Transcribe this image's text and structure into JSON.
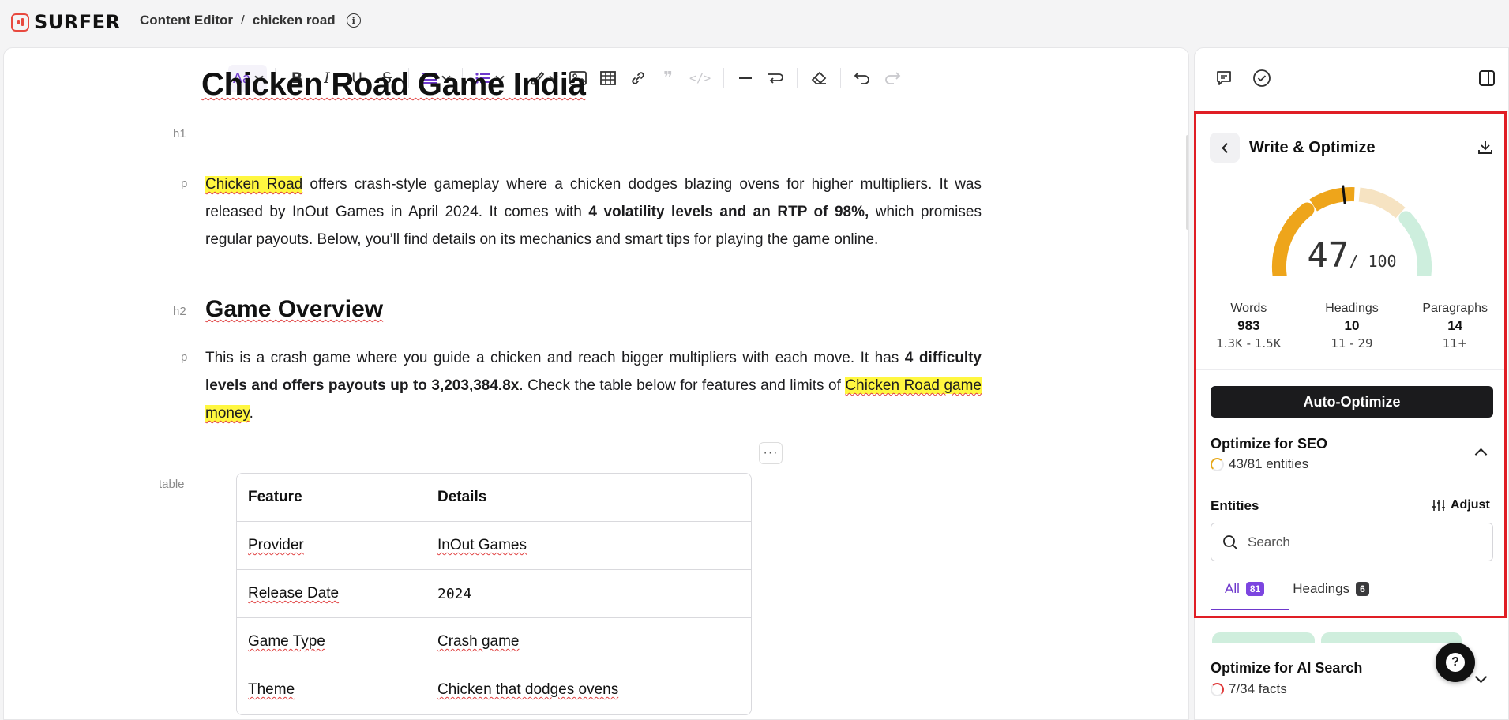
{
  "app": {
    "logo_text": "SURFER",
    "brand_color": "#e8493f",
    "accent_color": "#6e38cc"
  },
  "breadcrumb": {
    "section": "Content Editor",
    "separator": "/",
    "document": "chicken road",
    "info_icon": "info-icon"
  },
  "toolbar": {
    "font_button": "Aa",
    "items": [
      "text-format",
      "bold",
      "italic",
      "underline",
      "strikethrough",
      "align",
      "bullet-list",
      "paint",
      "image",
      "table",
      "link",
      "quote",
      "code",
      "divider",
      "line-break",
      "clear-format",
      "undo",
      "redo"
    ]
  },
  "editor": {
    "h1_tag": "h1",
    "h1": "Chicken Road Game India",
    "p_tag": "p",
    "p1": {
      "hl": "Chicken Road",
      "a": " offers crash-style gameplay where a chicken dodges blazing ovens for higher multipliers. It was released by InOut Games in April 2024. It comes with ",
      "b": "4 volatility levels and an RTP of 98%,",
      "c": " which promises regular payouts. Below, you’ll find details on its mechanics and smart tips for playing the game online."
    },
    "h2_tag": "h2",
    "h2": "Game Overview",
    "p2": {
      "a": "This is a crash game where you guide a chicken and reach bigger multipliers with each move. It has ",
      "b": "4 difficulty levels and offers payouts up to 3,203,384.8x",
      "c": ". Check the table below for features and limits of ",
      "hl": "Chicken Road game money",
      "d": "."
    },
    "table_tag": "table",
    "more_button": "···",
    "table": {
      "headers": [
        "Feature",
        "Details"
      ],
      "rows": [
        [
          "Provider",
          "InOut Games"
        ],
        [
          "Release Date",
          "2024"
        ],
        [
          "Game Type",
          "Crash game"
        ],
        [
          "Theme",
          "Chicken that dodges ovens"
        ]
      ]
    }
  },
  "panel": {
    "title": "Write & Optimize",
    "score": "47",
    "score_max": "/ 100",
    "score_value": 47,
    "stats": [
      {
        "label": "Words",
        "value": "983",
        "range": "1.3K - 1.5K"
      },
      {
        "label": "Headings",
        "value": "10",
        "range": "11 - 29"
      },
      {
        "label": "Paragraphs",
        "value": "14",
        "range": "11+"
      }
    ],
    "auto_optimize": "Auto-Optimize",
    "seo": {
      "title": "Optimize for SEO",
      "sub": "43/81 entities"
    },
    "entities": {
      "title": "Entities",
      "adjust": "Adjust",
      "search_placeholder": "Search"
    },
    "tabs": [
      {
        "label": "All",
        "count": "81"
      },
      {
        "label": "Headings",
        "count": "6"
      }
    ],
    "ai": {
      "title": "Optimize for AI Search",
      "sub": "7/34 facts"
    },
    "help": "?"
  }
}
